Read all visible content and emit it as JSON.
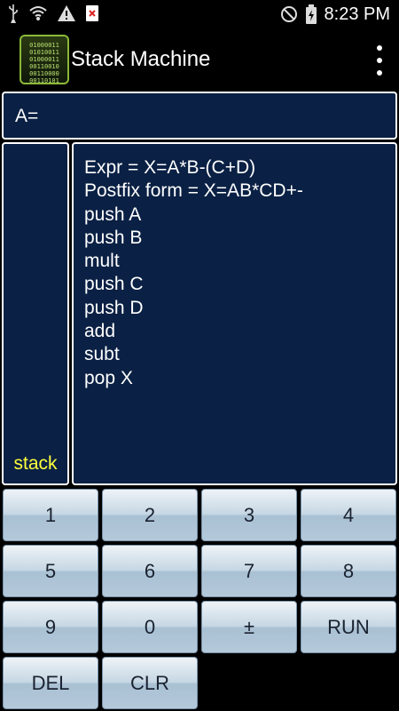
{
  "status_bar": {
    "time": "8:23 PM",
    "left_icons": [
      "usb-icon",
      "wifi-icon",
      "warning-icon",
      "notification-icon"
    ],
    "right_icons": [
      "no-disturb-icon",
      "battery-charging-icon"
    ]
  },
  "app": {
    "title": "Stack Machine",
    "icon_text": [
      "01000011",
      "01010011",
      "01000011",
      "00110010",
      "00110000",
      "00110101"
    ]
  },
  "accumulator": {
    "label": "A="
  },
  "stack": {
    "label": "stack"
  },
  "program": {
    "lines": [
      "Expr = X=A*B-(C+D)",
      "Postfix form = X=AB*CD+-",
      "push A",
      "push B",
      "mult",
      "push C",
      "push D",
      "add",
      "subt",
      "pop X"
    ]
  },
  "keypad": {
    "keys": [
      "1",
      "2",
      "3",
      "4",
      "5",
      "6",
      "7",
      "8",
      "9",
      "0",
      "±",
      "RUN",
      "DEL",
      "CLR"
    ]
  },
  "colors": {
    "panel_bg": "#0a2044",
    "stack_label": "#ffff3c",
    "key_face": "#c6d7e4"
  }
}
